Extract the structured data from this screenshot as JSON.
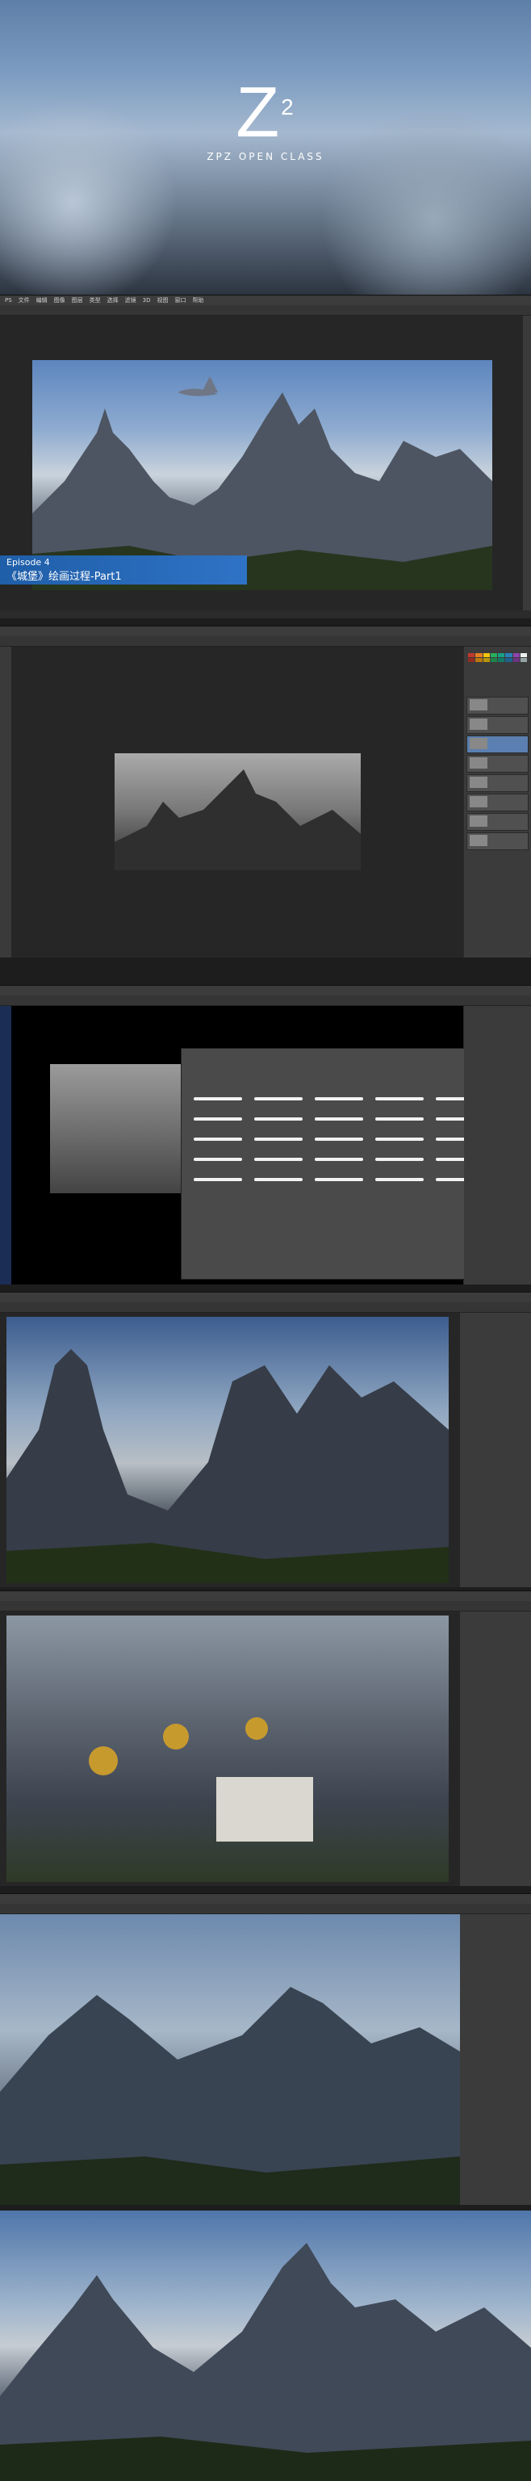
{
  "hero": {
    "logo_letter": "Z",
    "logo_sup": "2",
    "subtitle": "ZPZ OPEN CLASS"
  },
  "app": {
    "menu": [
      "PS",
      "文件",
      "编辑",
      "图像",
      "图层",
      "类型",
      "选择",
      "滤镜",
      "3D",
      "视图",
      "窗口",
      "帮助"
    ]
  },
  "episode": {
    "label": "Episode 4",
    "title": "《城堡》绘画过程-Part1"
  },
  "colors": {
    "accent": "#2f73c6",
    "ps_bg": "#2b2b2b",
    "ps_panel": "#3b3b3b"
  },
  "icons": {
    "hero_logo": "zpz-logo-icon",
    "tool": "tool-icon",
    "layer_eye": "eye-icon"
  }
}
